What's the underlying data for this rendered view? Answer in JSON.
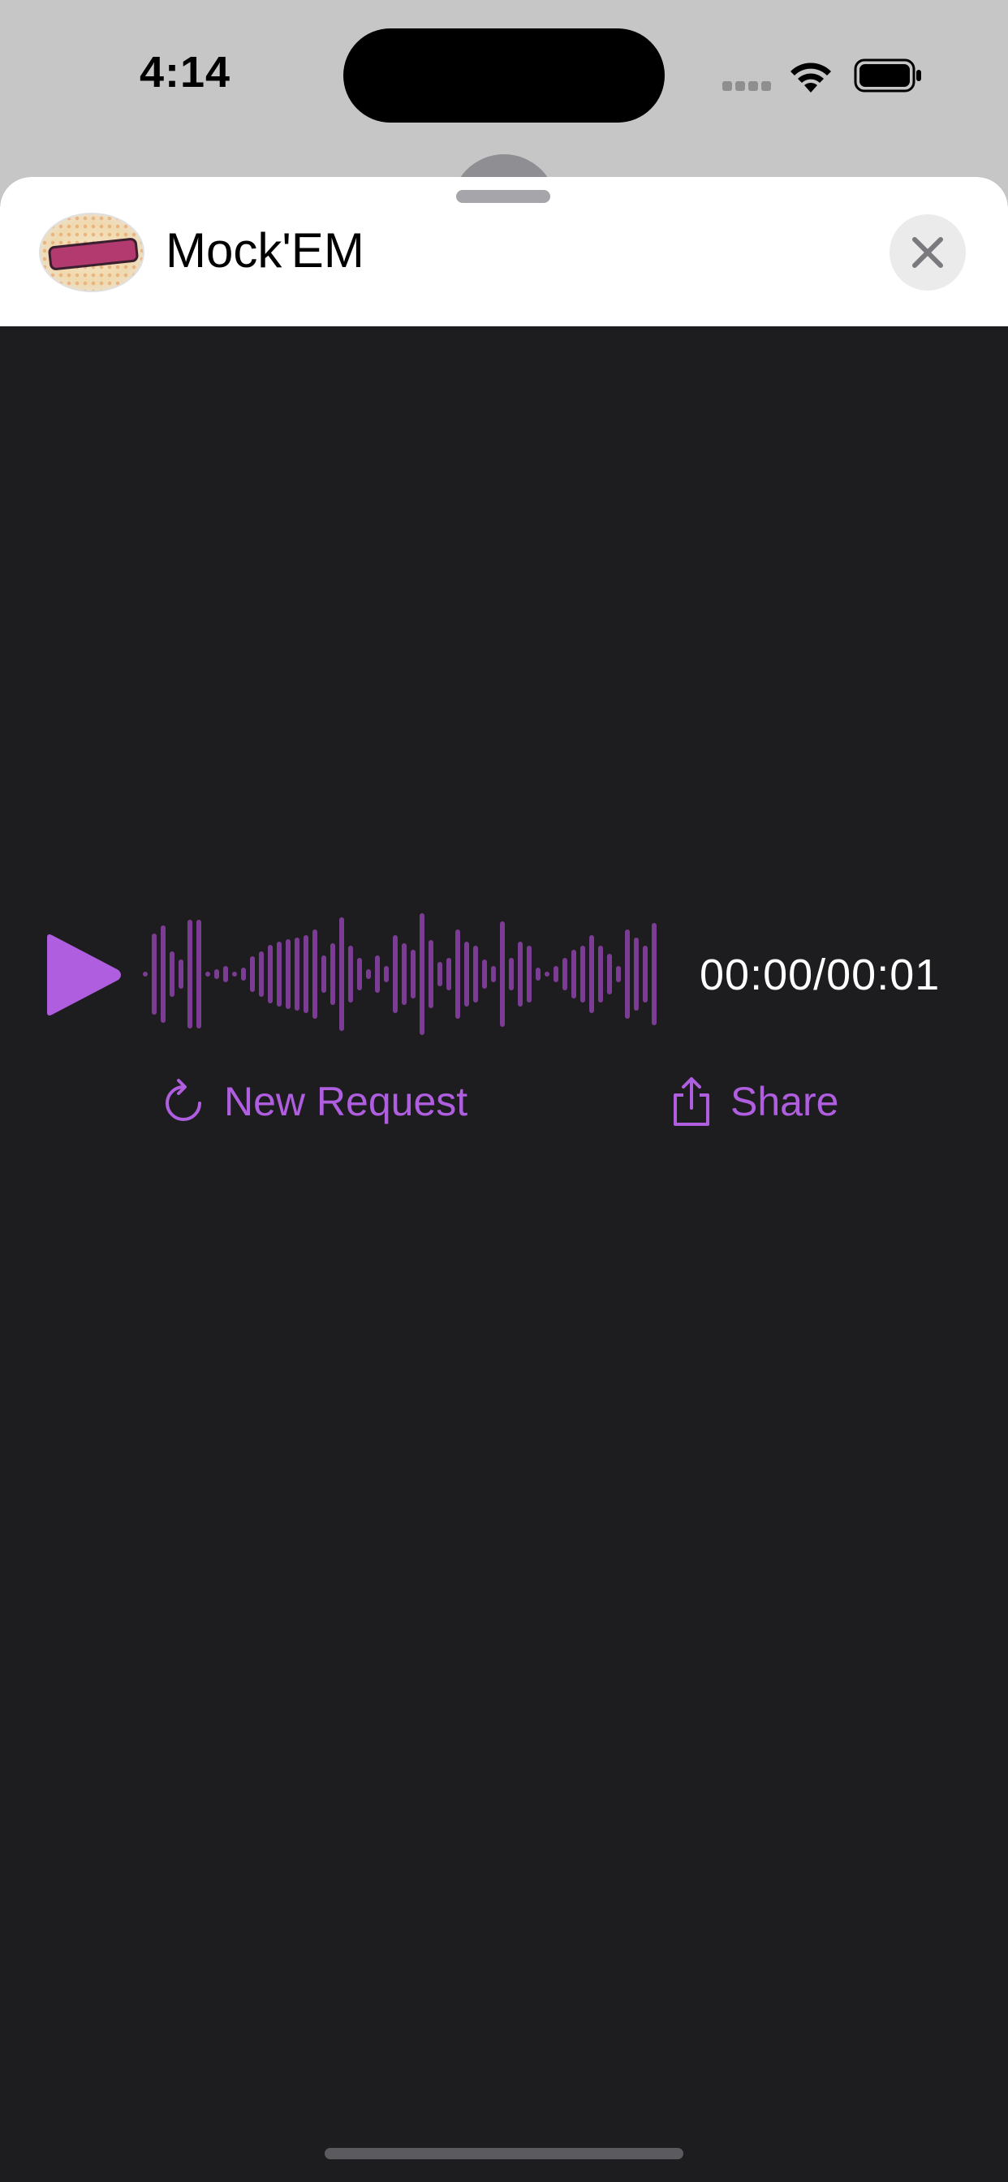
{
  "status_bar": {
    "time": "4:14",
    "icons": [
      "cellular-signal-icon",
      "wifi-icon",
      "battery-icon"
    ]
  },
  "sheet": {
    "app_title": "Mock'EM",
    "logo_icon": "mockem-logo",
    "close_icon": "close-icon"
  },
  "player": {
    "play_icon": "play-icon",
    "timecode": "00:00/00:01",
    "accent_color": "#b05ee0",
    "waveform_color": "#7b3d94"
  },
  "actions": {
    "new_request_label": "New Request",
    "new_request_icon": "refresh-icon",
    "share_label": "Share",
    "share_icon": "share-icon"
  },
  "colors": {
    "sheet_background": "#1d1d1f",
    "header_background": "#ffffff",
    "status_background": "#c6c6c6"
  }
}
